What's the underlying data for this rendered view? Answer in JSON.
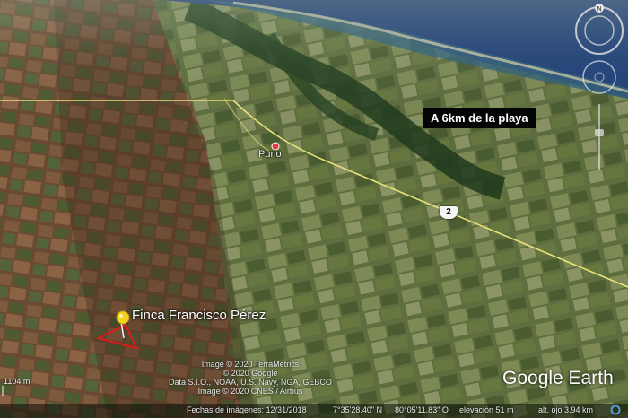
{
  "map": {
    "place_label": "Purio",
    "callout": "A 6km de la playa",
    "route_shield": "2",
    "placemark_label": "Finca Francisco Pérez"
  },
  "attribution": [
    "Image © 2020 TerraMetrics",
    "© 2020 Google",
    "Data S.I.O., NOAA, U.S. Navy, NGA, GEBCO",
    "Image © 2020 CNES / Airbus"
  ],
  "brand": "Google Earth",
  "scale": "1104 m",
  "status_bar": {
    "imagery_date": "Fechas de imágenes: 12/31/2018",
    "latitude": "7°35'28.40\" N",
    "longitude": "80°05'11.83\" O",
    "elevation": "elevación   51 m",
    "eye_altitude": "alt. ojo   3.94 km"
  },
  "nav": {
    "north": "N"
  },
  "colors": {
    "sea": "#1f3f78",
    "callout_bg": "#050505",
    "placemark": "#f4d21c",
    "road": "#e8e27a",
    "polygon": "#e01a1a"
  },
  "icons": [
    "compass-icon",
    "look-joystick-icon",
    "zoom-slider-icon",
    "placemark-pushpin-icon",
    "place-pin-icon",
    "status-circle-icon"
  ]
}
